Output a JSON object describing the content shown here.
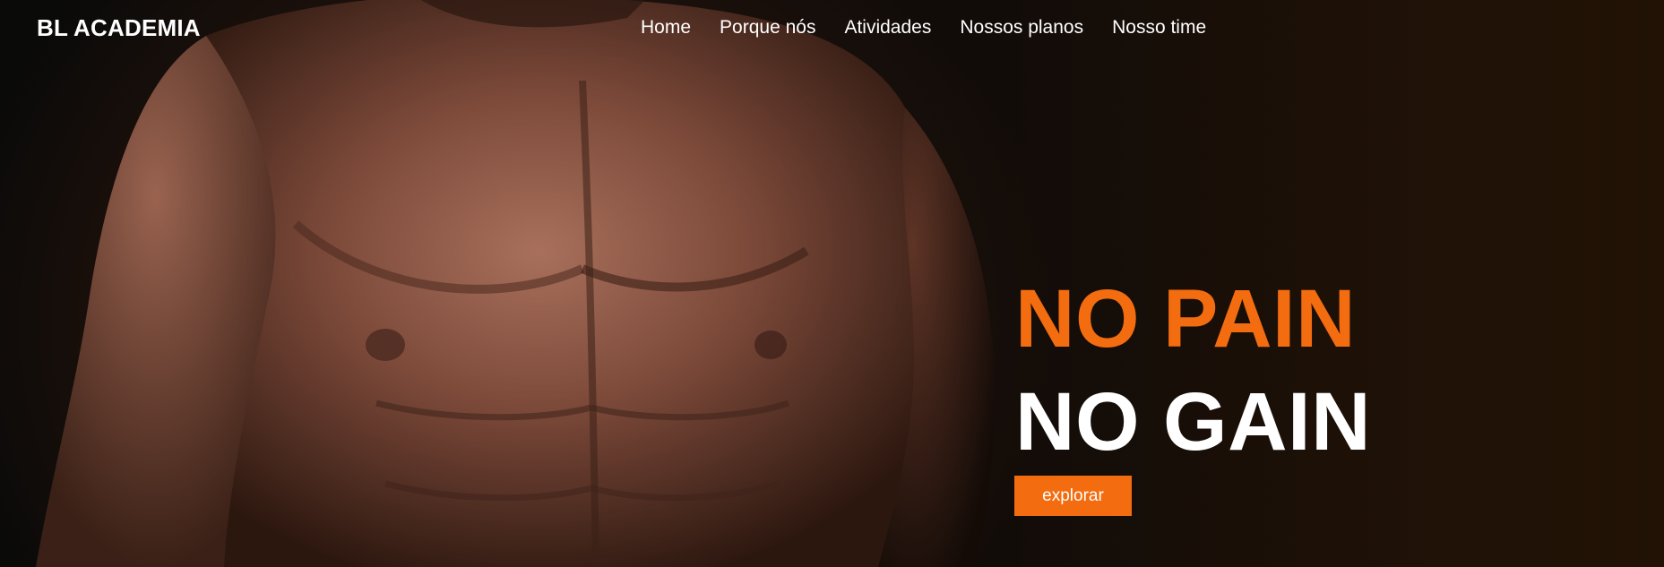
{
  "header": {
    "brand": "BL ACADEMIA",
    "nav": [
      {
        "label": "Home"
      },
      {
        "label": "Porque nós"
      },
      {
        "label": "Atividades"
      },
      {
        "label": "Nossos planos"
      },
      {
        "label": "Nosso time"
      }
    ]
  },
  "hero": {
    "headline_line1": "NO PAIN",
    "headline_line2": "NO GAIN",
    "cta_label": "explorar"
  },
  "colors": {
    "accent": "#f36c10",
    "text": "#ffffff",
    "background": "#0b0806"
  }
}
